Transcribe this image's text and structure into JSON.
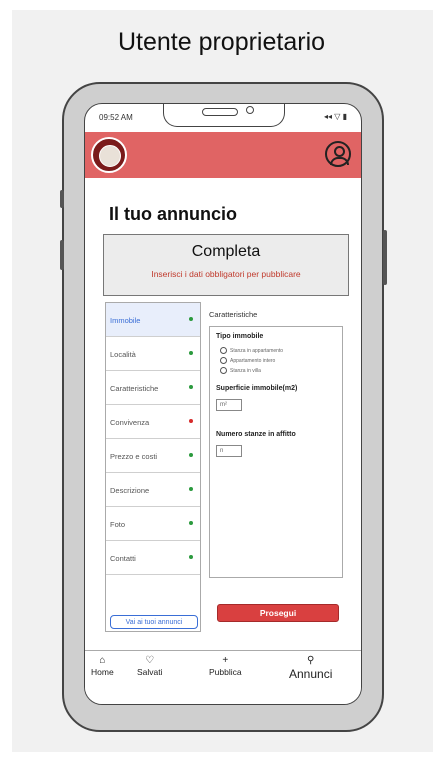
{
  "page_heading": "Utente proprietario",
  "status_bar": {
    "time": "09:52 AM",
    "icons": "◂◂ ▽ ▮"
  },
  "title": "Il tuo annuncio",
  "completion": {
    "title": "Completa",
    "subtitle": "Inserisci i dati obbligatori per pubblicare"
  },
  "sidebar": {
    "items": [
      {
        "label": "Immobile",
        "status": "complete"
      },
      {
        "label": "Località",
        "status": "complete"
      },
      {
        "label": "Caratteristiche",
        "status": "complete"
      },
      {
        "label": "Convivenza",
        "status": "incomplete"
      },
      {
        "label": "Prezzo e costi",
        "status": "complete"
      },
      {
        "label": "Descrizione",
        "status": "complete"
      },
      {
        "label": "Foto",
        "status": "complete"
      },
      {
        "label": "Contatti",
        "status": "complete"
      }
    ],
    "all_ads_button": "Vai ai tuoi annunci"
  },
  "content": {
    "section_title": "Caratteristiche",
    "property_type_label": "Tipo immobile",
    "property_type_options": [
      "Stanza in appartamento",
      "Appartamento intero",
      "Stanza in villa"
    ],
    "area_label": "Superficie immobile(m2)",
    "area_value": "m²",
    "rooms_label": "Numero stanze in affitto",
    "rooms_value": "n"
  },
  "proceed_button": "Prosegui",
  "bottom_nav": {
    "home": {
      "icon": "home-icon",
      "glyph": "⌂",
      "label": "Home"
    },
    "saved": {
      "icon": "heart-icon",
      "glyph": "♡",
      "label": "Salvati"
    },
    "publish": {
      "icon": "plus-icon",
      "glyph": "+",
      "label": "Pubblica"
    },
    "ads": {
      "icon": "pin-icon",
      "glyph": "⚲",
      "label": "Annunci"
    }
  },
  "colors": {
    "accent": "#e06464",
    "primary_button": "#d94040",
    "complete": "#2b9a3e",
    "incomplete": "#d62b2b",
    "link": "#3a6ed6"
  }
}
